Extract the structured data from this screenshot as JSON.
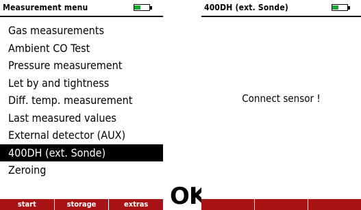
{
  "left_screen": {
    "title": "Measurement menu",
    "menu_items": [
      {
        "label": "Gas measurements",
        "selected": false
      },
      {
        "label": "Ambient CO Test",
        "selected": false
      },
      {
        "label": "Pressure measurement",
        "selected": false
      },
      {
        "label": "Let by and tightness",
        "selected": false
      },
      {
        "label": "Diff. temp. measurement",
        "selected": false
      },
      {
        "label": "Last measured values",
        "selected": false
      },
      {
        "label": "External detector (AUX)",
        "selected": false
      },
      {
        "label": "400DH (ext. Sonde)",
        "selected": true
      },
      {
        "label": "Zeroing",
        "selected": false
      }
    ],
    "softkeys": [
      "start",
      "storage",
      "extras"
    ]
  },
  "ok_label": "OK",
  "right_screen": {
    "title": "400DH (ext. Sonde)",
    "message": "Connect sensor !",
    "softkeys": [
      "",
      "",
      ""
    ]
  },
  "colors": {
    "softkey_bar": "#a81416",
    "battery_fill": "#1ba531",
    "selection": "#000000"
  },
  "icons": [
    "battery-icon"
  ]
}
